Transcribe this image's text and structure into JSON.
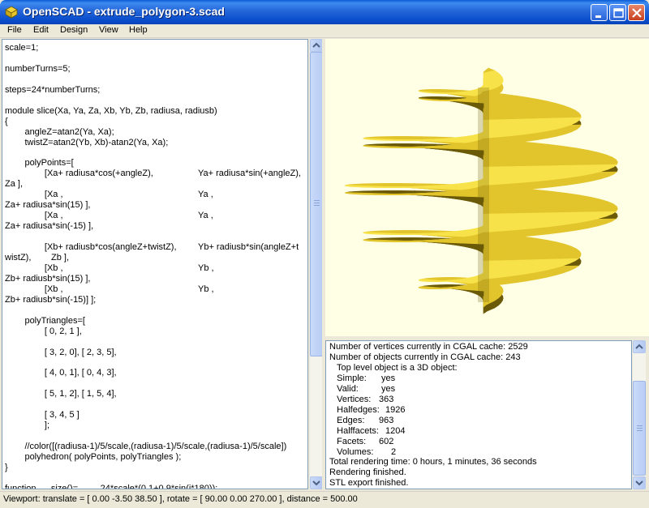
{
  "window": {
    "title": "OpenSCAD - extrude_polygon-3.scad"
  },
  "menu": [
    "File",
    "Edit",
    "Design",
    "View",
    "Help"
  ],
  "editor": {
    "lines": [
      "scale=1;",
      "",
      "numberTurns=5;",
      "",
      "steps=24*numberTurns;",
      "",
      "module slice(Xa, Ya, Za, Xb, Yb, Zb, radiusa, radiusb)",
      "{",
      "        angleZ=atan2(Ya, Xa);",
      "        twistZ=atan2(Yb, Xb)-atan2(Ya, Xa);",
      "",
      "        polyPoints=[",
      "                [Xa+ radiusa*cos(+angleZ),",
      "Za ],",
      "                [Xa ,",
      "Za+ radiusa*sin(15) ],",
      "                [Xa ,",
      "Za+ radiusa*sin(-15) ],",
      "",
      "                [Xb+ radiusb*cos(angleZ+twistZ),",
      "wistZ),",
      "                [Xb ,",
      "Zb+ radiusb*sin(15) ],",
      "                [Xb ,",
      "Zb+ radiusb*sin(-15)] ];",
      "",
      "        polyTriangles=[",
      "                [ 0, 2, 1 ],",
      "",
      "                [ 3, 2, 0], [ 2, 3, 5],",
      "",
      "                [ 4, 0, 1], [ 0, 4, 3],",
      "",
      "                [ 5, 1, 2], [ 1, 5, 4],",
      "",
      "                [ 3, 4, 5 ]",
      "                ];",
      "",
      "        //color([(radiusa-1)/5/scale,(radiusa-1)/5/scale,(radiusa-1)/5/scale])",
      "        polyhedron( polyPoints, polyTriangles );",
      "}",
      "",
      "function      size()=         24*scale*(0.1+0.9*sin(i*180));"
    ],
    "right_column": [
      {
        "line": 12,
        "text": "Ya+ radiusa*sin(+angleZ),"
      },
      {
        "line": 14,
        "text": "Ya ,"
      },
      {
        "line": 16,
        "text": "Ya ,"
      },
      {
        "line": 19,
        "text": "Yb+ radiusb*sin(angleZ+t"
      },
      {
        "line": 20,
        "text": "Zb ],"
      },
      {
        "line": 21,
        "text": "Yb ,"
      },
      {
        "line": 23,
        "text": "Yb ,"
      }
    ]
  },
  "console": {
    "lines": [
      "Number of vertices currently in CGAL cache: 2529",
      "Number of objects currently in CGAL cache: 243",
      "   Top level object is a 3D object:",
      "   Simple:",
      "   Valid:",
      "   Vertices:",
      "   Halfedges:",
      "   Edges:",
      "   Halffacets:",
      "   Facets:",
      "   Volumes:",
      "Total rendering time: 0 hours, 1 minutes, 36 seconds",
      "Rendering finished.",
      "STL export finished."
    ],
    "values": [
      {
        "line": 3,
        "text": "yes"
      },
      {
        "line": 4,
        "text": "yes"
      },
      {
        "line": 5,
        "text": "363"
      },
      {
        "line": 6,
        "text": "1926"
      },
      {
        "line": 7,
        "text": "963"
      },
      {
        "line": 8,
        "text": "1204"
      },
      {
        "line": 9,
        "text": "602"
      },
      {
        "line": 10,
        "text": "2"
      }
    ]
  },
  "status": {
    "text": "Viewport: translate = [ 0.00 -3.50 38.50 ], rotate = [ 90.00 0.00 270.00 ], distance = 500.00"
  },
  "colors": {
    "viewport_bg": "#ffffe5",
    "mesh_light": "#f8e24a",
    "mesh_mid": "#e2c52c",
    "mesh_dark": "#6b5a08"
  }
}
